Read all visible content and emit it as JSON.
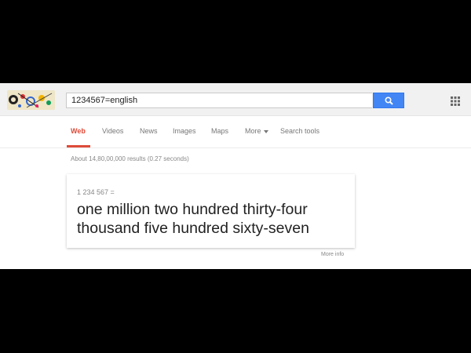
{
  "search": {
    "query": "1234567=english",
    "button_icon": "search-icon"
  },
  "header": {
    "logo_icon": "google-doodle",
    "apps_icon": "apps-grid-icon"
  },
  "tabs": [
    {
      "label": "Web",
      "active": true
    },
    {
      "label": "Videos",
      "active": false
    },
    {
      "label": "News",
      "active": false
    },
    {
      "label": "Images",
      "active": false
    },
    {
      "label": "Maps",
      "active": false
    },
    {
      "label": "More",
      "active": false
    },
    {
      "label": "Search tools",
      "active": false
    }
  ],
  "results": {
    "stats": "About 14,80,00,000 results (0.27 seconds)"
  },
  "answer": {
    "equation": "1 234 567 =",
    "line1": "one million two hundred thirty-four",
    "line2": "thousand five hundred sixty-seven",
    "more_info": "More info"
  },
  "colors": {
    "accent": "#dd4b39",
    "search_button": "#4285f4",
    "background_letterbox": "#000000"
  }
}
